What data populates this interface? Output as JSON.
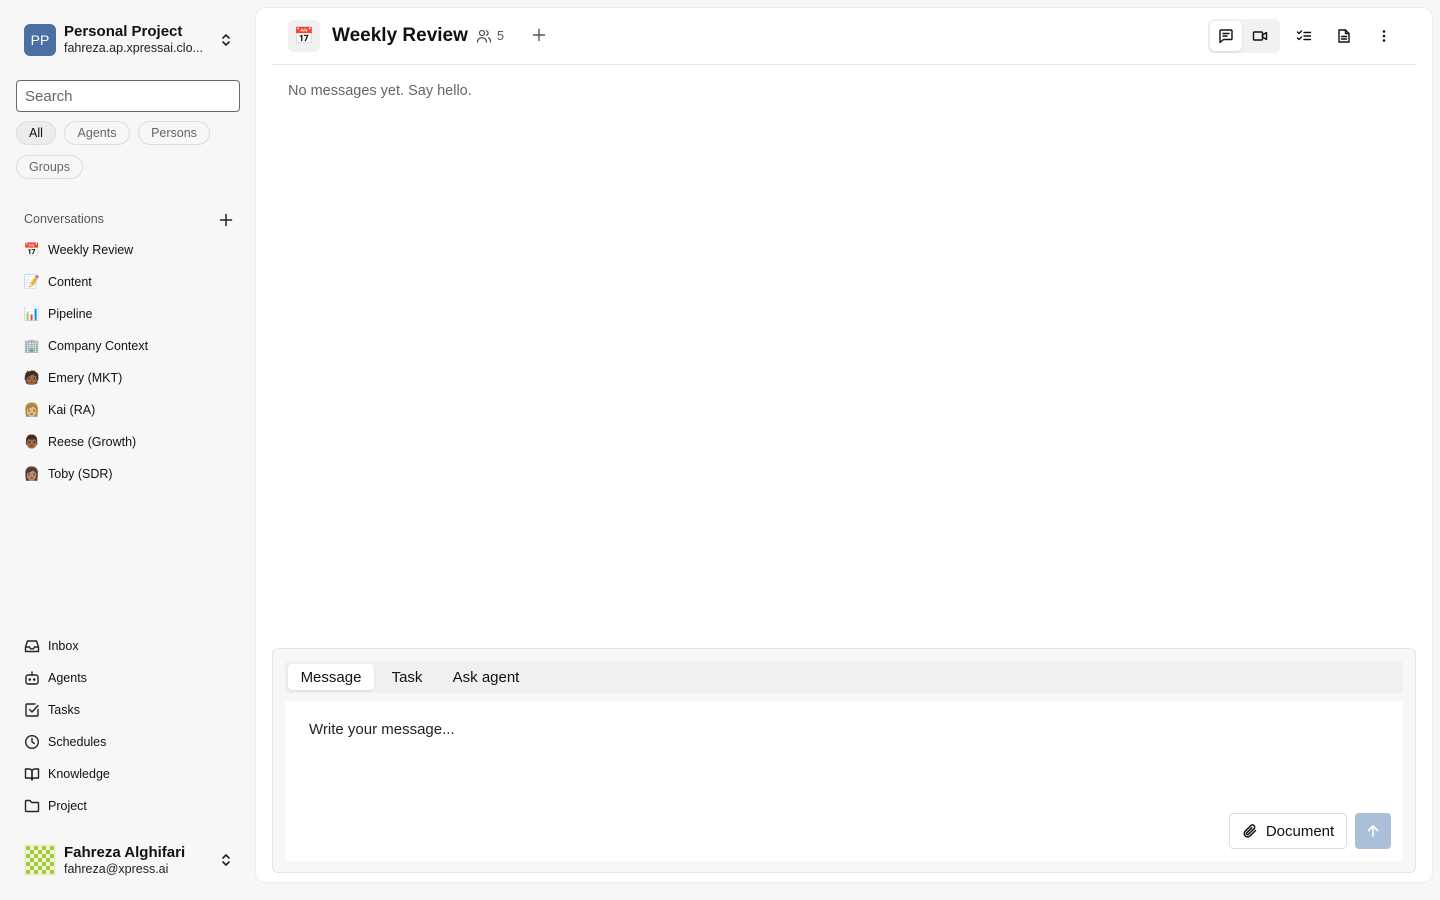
{
  "project": {
    "initials": "PP",
    "name": "Personal Project",
    "subtitle": "fahreza.ap.xpressai.clo..."
  },
  "search": {
    "placeholder": "Search"
  },
  "filters": [
    "All",
    "Agents",
    "Persons",
    "Groups"
  ],
  "conversations": {
    "heading": "Conversations",
    "items": [
      {
        "emoji": "📅",
        "label": "Weekly Review"
      },
      {
        "emoji": "📝",
        "label": "Content"
      },
      {
        "emoji": "📊",
        "label": "Pipeline"
      },
      {
        "emoji": "🏢",
        "label": "Company Context"
      },
      {
        "emoji": "🧑🏾",
        "label": "Emery (MKT)"
      },
      {
        "emoji": "👩🏼",
        "label": "Kai (RA)"
      },
      {
        "emoji": "👨🏾",
        "label": "Reese (Growth)"
      },
      {
        "emoji": "👩🏽",
        "label": "Toby (SDR)"
      }
    ]
  },
  "nav": [
    {
      "icon": "inbox-icon",
      "label": "Inbox"
    },
    {
      "icon": "bot-icon",
      "label": "Agents"
    },
    {
      "icon": "check-square-icon",
      "label": "Tasks"
    },
    {
      "icon": "clock-icon",
      "label": "Schedules"
    },
    {
      "icon": "book-icon",
      "label": "Knowledge"
    },
    {
      "icon": "folder-icon",
      "label": "Project"
    }
  ],
  "user": {
    "name": "Fahreza Alghifari",
    "email": "fahreza@xpress.ai"
  },
  "header": {
    "emoji": "📅",
    "title": "Weekly Review",
    "member_count": "5"
  },
  "empty_state": "No messages yet. Say hello.",
  "composer": {
    "tabs": [
      "Message",
      "Task",
      "Ask agent"
    ],
    "active_tab": "Message",
    "placeholder": "Write your message...",
    "document_label": "Document"
  },
  "colors": {
    "project_avatar": "#4a6fa5",
    "send_button_disabled": "#a9c0d8"
  }
}
